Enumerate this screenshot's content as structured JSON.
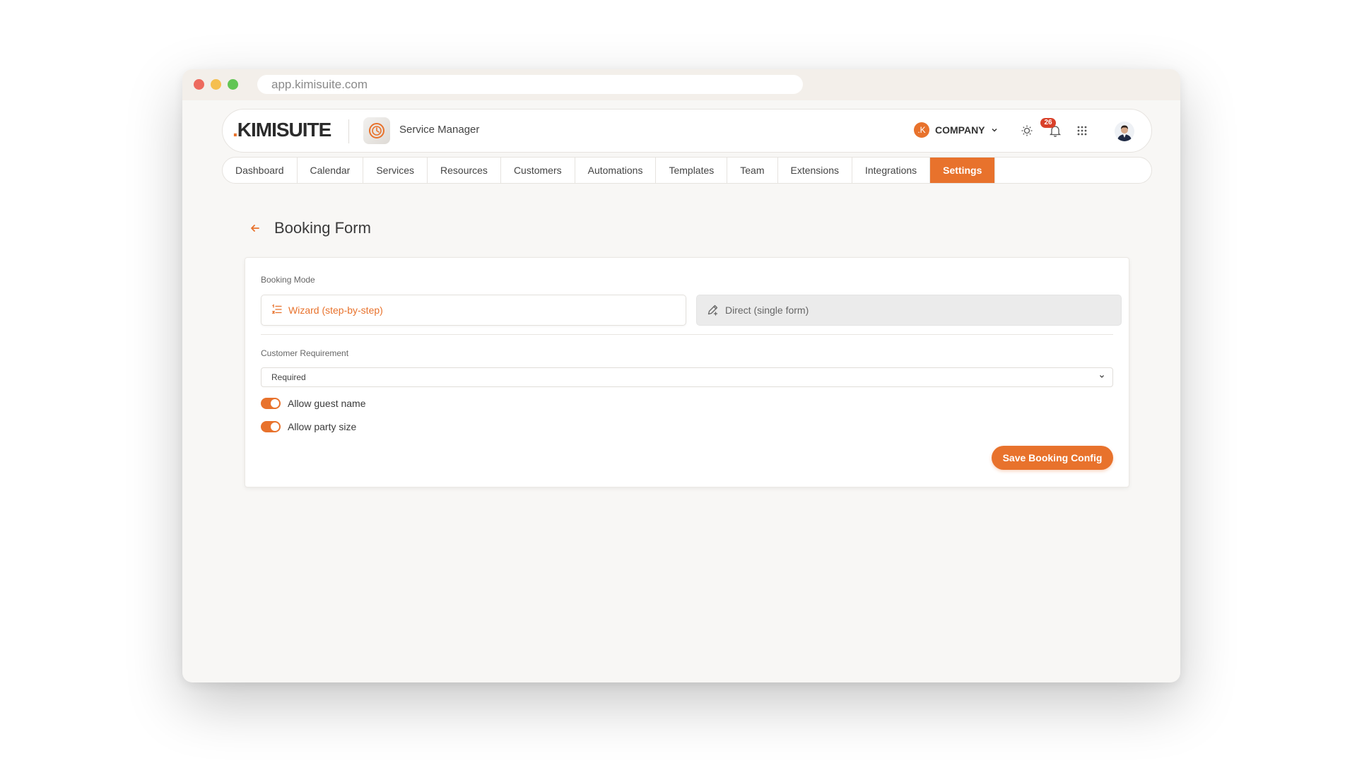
{
  "browser": {
    "url": "app.kimisuite.com"
  },
  "header": {
    "logo_dot": ".",
    "logo_text": "KIMISUITE",
    "app_name": "Service Manager",
    "company_initial": ".K",
    "company_label": "COMPANY",
    "notification_count": "26"
  },
  "nav": {
    "tabs": [
      {
        "label": "Dashboard"
      },
      {
        "label": "Calendar"
      },
      {
        "label": "Services"
      },
      {
        "label": "Resources"
      },
      {
        "label": "Customers"
      },
      {
        "label": "Automations"
      },
      {
        "label": "Templates"
      },
      {
        "label": "Team"
      },
      {
        "label": "Extensions"
      },
      {
        "label": "Integrations"
      },
      {
        "label": "Settings",
        "active": true
      }
    ]
  },
  "page": {
    "title": "Booking Form"
  },
  "form": {
    "booking_mode_label": "Booking Mode",
    "mode_options": [
      {
        "label": "Wizard (step-by-step)",
        "icon": "list-numbered-icon",
        "selected": true
      },
      {
        "label": "Direct (single form)",
        "icon": "pencil-plus-icon",
        "selected": false
      }
    ],
    "customer_requirement_label": "Customer Requirement",
    "customer_requirement_value": "Required",
    "toggles": [
      {
        "label": "Allow guest name",
        "on": true
      },
      {
        "label": "Allow party size",
        "on": true
      }
    ],
    "save_label": "Save Booking Config"
  },
  "colors": {
    "accent": "#e8722c",
    "badge": "#d9412a",
    "background": "#f8f7f5"
  }
}
